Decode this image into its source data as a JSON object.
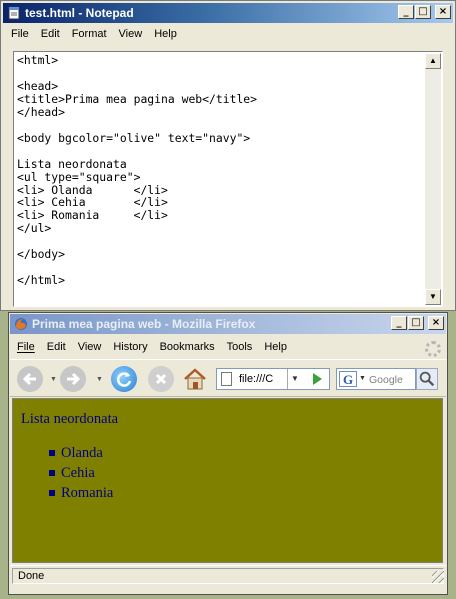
{
  "notepad": {
    "title": "test.html - Notepad",
    "menu": [
      "File",
      "Edit",
      "Format",
      "View",
      "Help"
    ],
    "content": "<html>\n\n<head>\n<title>Prima mea pagina web</title>\n</head>\n\n<body bgcolor=\"olive\" text=\"navy\">\n\nLista neordonata\n<ul type=\"square\">\n<li> Olanda      </li>\n<li> Cehia       </li>\n<li> Romania     </li>\n</ul>\n\n</body>\n\n</html>",
    "window_buttons": [
      "_",
      "□",
      "×"
    ]
  },
  "firefox": {
    "title": "Prima mea pagina web - Mozilla Firefox",
    "menu": [
      "File",
      "Edit",
      "View",
      "History",
      "Bookmarks",
      "Tools",
      "Help"
    ],
    "url": "file:///C",
    "search_engine_letter": "G",
    "search_placeholder": "Google",
    "window_buttons": [
      "_",
      "□",
      "×"
    ],
    "page": {
      "text": "Lista neordonata",
      "list": [
        "Olanda",
        "Cehia",
        "Romania"
      ],
      "bgcolor": "#808000",
      "textcolor": "#000080"
    },
    "status": "Done"
  },
  "icons": [
    "notepad-icon",
    "firefox-icon",
    "back-icon",
    "forward-icon",
    "reload-icon",
    "stop-icon",
    "home-icon",
    "page-icon",
    "go-icon",
    "google-icon",
    "magnifier-icon",
    "throbber-icon"
  ]
}
